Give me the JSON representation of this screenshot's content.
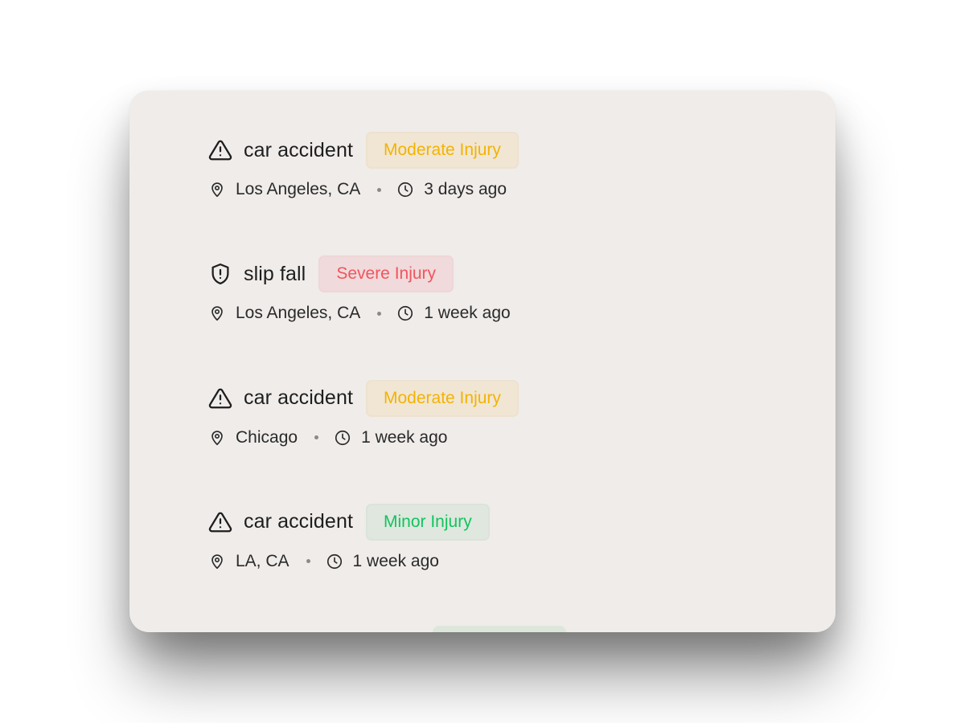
{
  "incidents": [
    {
      "icon": "warning-triangle-icon",
      "title": "car accident",
      "severity": "Moderate Injury",
      "severity_level": "moderate",
      "location": "Los Angeles, CA",
      "time": "3 days ago"
    },
    {
      "icon": "shield-alert-icon",
      "title": "slip fall",
      "severity": "Severe Injury",
      "severity_level": "severe",
      "location": "Los Angeles, CA",
      "time": "1 week ago"
    },
    {
      "icon": "warning-triangle-icon",
      "title": "car accident",
      "severity": "Moderate Injury",
      "severity_level": "moderate",
      "location": "Chicago",
      "time": "1 week ago"
    },
    {
      "icon": "warning-triangle-icon",
      "title": "car accident",
      "severity": "Minor Injury",
      "severity_level": "minor",
      "location": "LA, CA",
      "time": "1 week ago"
    }
  ],
  "colors": {
    "card_background": "#efecea",
    "moderate": "#f3b300",
    "severe": "#f2545f",
    "minor": "#12c45e"
  }
}
